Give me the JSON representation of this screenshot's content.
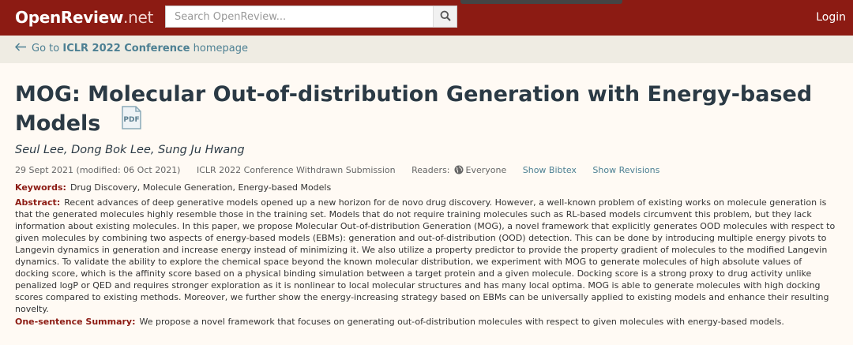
{
  "navbar": {
    "brand_main": "OpenReview",
    "brand_tld": ".net",
    "search_placeholder": "Search OpenReview...",
    "login_label": "Login"
  },
  "subnav": {
    "prefix": "Go to",
    "venue": "ICLR 2022 Conference",
    "suffix": "homepage"
  },
  "paper": {
    "title": "MOG: Molecular Out-of-distribution Generation with Energy-based Models",
    "authors": "Seul Lee, Dong Bok Lee, Sung Ju Hwang",
    "date": "29 Sept 2021 (modified: 06 Oct 2021)",
    "venue": "ICLR 2022 Conference Withdrawn Submission",
    "readers_label": "Readers:",
    "readers_value": "Everyone",
    "show_bibtex": "Show Bibtex",
    "show_revisions": "Show Revisions",
    "keywords_label": "Keywords:",
    "keywords": "Drug Discovery, Molecule Generation, Energy-based Models",
    "abstract_label": "Abstract:",
    "abstract": "Recent advances of deep generative models opened up a new horizon for de novo drug discovery. However, a well-known problem of existing works on molecule generation is that the generated molecules highly resemble those in the training set. Models that do not require training molecules such as RL-based models circumvent this problem, but they lack information about existing molecules. In this paper, we propose Molecular Out-of-distribution Generation (MOG), a novel framework that explicitly generates OOD molecules with respect to given molecules by combining two aspects of energy-based models (EBMs): generation and out-of-distribution (OOD) detection. This can be done by introducing multiple energy pivots to Langevin dynamics in generation and increase energy instead of minimizing it. We also utilize a property predictor to provide the property gradient of molecules to the modified Langevin dynamics. To validate the ability to explore the chemical space beyond the known molecular distribution, we experiment with MOG to generate molecules of high absolute values of docking score, which is the affinity score based on a physical binding simulation between a target protein and a given molecule. Docking score is a strong proxy to drug activity unlike penalized logP or QED and requires stronger exploration as it is nonlinear to local molecular structures and has many local optima. MOG is able to generate molecules with high docking scores compared to existing methods. Moreover, we further show the energy-increasing strategy based on EBMs can be universally applied to existing models and enhance their resulting novelty.",
    "summary_label": "One-sentence Summary:",
    "summary": "We propose a novel framework that focuses on generating out-of-distribution molecules with respect to given molecules with energy-based models."
  },
  "colors": {
    "navbar": "#8c1b13",
    "subnav": "#efece3",
    "page": "#fffaf4",
    "link": "#4d8093",
    "label": "#8c1b13",
    "title": "#2b3a45"
  }
}
